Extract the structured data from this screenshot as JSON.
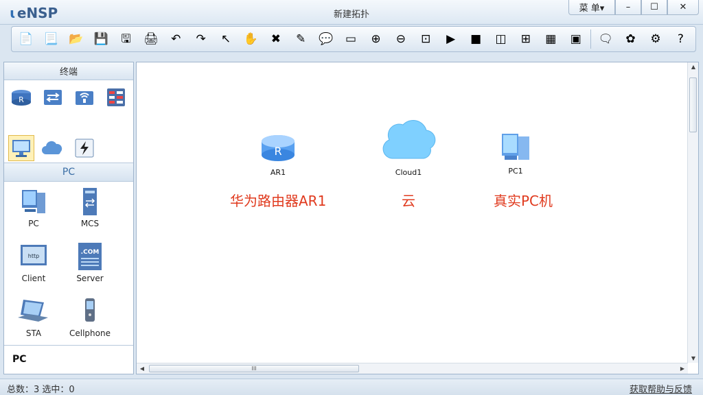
{
  "app": {
    "logo_text": "eNSP",
    "window_title": "新建拓扑"
  },
  "window_controls": {
    "menu_label": "菜 单▾",
    "minimize": "–",
    "maximize": "☐",
    "close": "✕"
  },
  "toolbar": {
    "buttons": [
      {
        "name": "new-topology",
        "icon": "📄"
      },
      {
        "name": "new-template",
        "icon": "📃"
      },
      {
        "name": "open",
        "icon": "📂"
      },
      {
        "name": "save",
        "icon": "💾"
      },
      {
        "name": "save-as",
        "icon": "🖫"
      },
      {
        "name": "print",
        "icon": "🖨"
      },
      {
        "name": "undo",
        "icon": "↶"
      },
      {
        "name": "redo",
        "icon": "↷"
      },
      {
        "name": "select",
        "icon": "↖"
      },
      {
        "name": "drag",
        "icon": "✋"
      },
      {
        "name": "delete",
        "icon": "✖"
      },
      {
        "name": "delete-all",
        "icon": "✎"
      },
      {
        "name": "text",
        "icon": "💬"
      },
      {
        "name": "palette",
        "icon": "▭"
      },
      {
        "name": "zoom-in",
        "icon": "⊕"
      },
      {
        "name": "zoom-out",
        "icon": "⊖"
      },
      {
        "name": "fit",
        "icon": "⊡"
      },
      {
        "name": "start",
        "icon": "▶"
      },
      {
        "name": "stop",
        "icon": "■"
      },
      {
        "name": "capture",
        "icon": "◫"
      },
      {
        "name": "topology",
        "icon": "⊞"
      },
      {
        "name": "grid",
        "icon": "▦"
      },
      {
        "name": "console",
        "icon": "▣"
      }
    ],
    "right_buttons": [
      {
        "name": "chat",
        "icon": "🗨"
      },
      {
        "name": "huawei",
        "icon": "✿"
      },
      {
        "name": "settings",
        "icon": "⚙"
      },
      {
        "name": "help",
        "icon": "?"
      }
    ]
  },
  "left_panel": {
    "section_title": "终端",
    "category_icons": [
      "router-icon",
      "switch-icon",
      "wireless-icon",
      "firewall-icon",
      "pc-category-icon",
      "cloud-category-icon",
      "other-device-icon"
    ],
    "group_title": "PC",
    "devices": [
      {
        "label": "PC",
        "icon": "pc-icon"
      },
      {
        "label": "MCS",
        "icon": "mcs-icon"
      },
      {
        "label": "Client",
        "icon": "client-icon"
      },
      {
        "label": "Server",
        "icon": "server-icon"
      },
      {
        "label": "STA",
        "icon": "sta-icon"
      },
      {
        "label": "Cellphone",
        "icon": "cellphone-icon"
      }
    ],
    "client_screen_text": "http",
    "server_screen_text": ".COM",
    "selected_info": "PC"
  },
  "canvas": {
    "nodes": [
      {
        "id": "ar1",
        "label": "AR1",
        "icon_text": "R"
      },
      {
        "id": "cloud1",
        "label": "Cloud1"
      },
      {
        "id": "pc1",
        "label": "PC1"
      }
    ],
    "annotations": [
      {
        "target": "ar1",
        "text": "华为路由器AR1"
      },
      {
        "target": "cloud1",
        "text": "云"
      },
      {
        "target": "pc1",
        "text": "真实PC机"
      }
    ],
    "hscroll_grip": "III"
  },
  "status_bar": {
    "text": "总数：3  选中：0",
    "help_link": "获取帮助与反馈"
  },
  "colors": {
    "annotation": "#e03a1e",
    "accent": "#3a6ea5",
    "panel_bg": "#dbe6f1"
  }
}
